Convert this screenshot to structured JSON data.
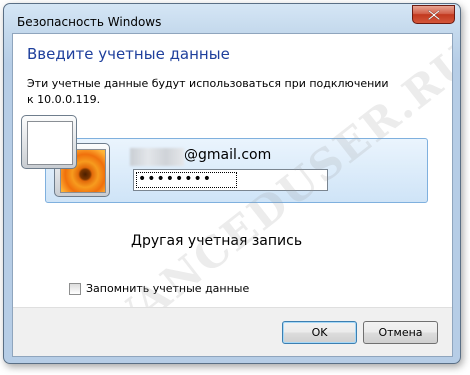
{
  "window": {
    "title": "Безопасность Windows"
  },
  "dialog": {
    "heading": "Введите учетные данные",
    "description": "Эти учетные данные будут использоваться при подключении к 10.0.0.119."
  },
  "credential": {
    "email_suffix": "@gmail.com",
    "password_value": "••••••••"
  },
  "other_account": {
    "label": "Другая учетная запись"
  },
  "remember": {
    "label": "Запомнить учетные данные",
    "checked": false
  },
  "buttons": {
    "ok": "OK",
    "cancel": "Отмена"
  },
  "watermark": "ADVANCEDUSER.RU",
  "colors": {
    "heading": "#1e3f9c",
    "selection_bg": "#cfe4f7",
    "close_button": "#c2391f"
  },
  "icons": {
    "close": "close-icon",
    "avatar": "user-flower-icon"
  }
}
